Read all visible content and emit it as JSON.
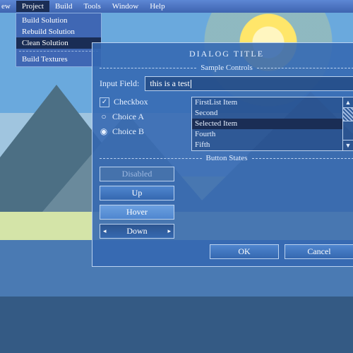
{
  "menubar": {
    "items": [
      "ew",
      "Project",
      "Build",
      "Tools",
      "Window",
      "Help"
    ],
    "activeIndex": 1
  },
  "dropdown": {
    "items": [
      "Build Solution",
      "Rebuild Solution",
      "Clean Solution"
    ],
    "extra": [
      "Build Textures"
    ],
    "selected": "Clean Solution"
  },
  "dialog": {
    "title": "DIALOG TITLE",
    "sections": {
      "controls": "Sample Controls",
      "buttons": "Button States"
    },
    "inputLabel": "Input Field:",
    "inputValue": "this is a test",
    "checkbox": {
      "label": "Checkbox",
      "checked": true
    },
    "radios": [
      {
        "label": "Choice A",
        "selected": false
      },
      {
        "label": "Choice B",
        "selected": true
      }
    ],
    "list": {
      "items": [
        "FirstList Item",
        "Second",
        "Selected Item",
        "Fourth",
        "Fifth"
      ],
      "selected": "Selected Item"
    },
    "buttonStates": {
      "disabled": "Disabled",
      "up": "Up",
      "hover": "Hover",
      "down": "Down"
    },
    "ok": "OK",
    "cancel": "Cancel"
  },
  "colors": {
    "panel": "#3468b2",
    "accent": "#bcd3f0",
    "select": "#1a2d55"
  }
}
